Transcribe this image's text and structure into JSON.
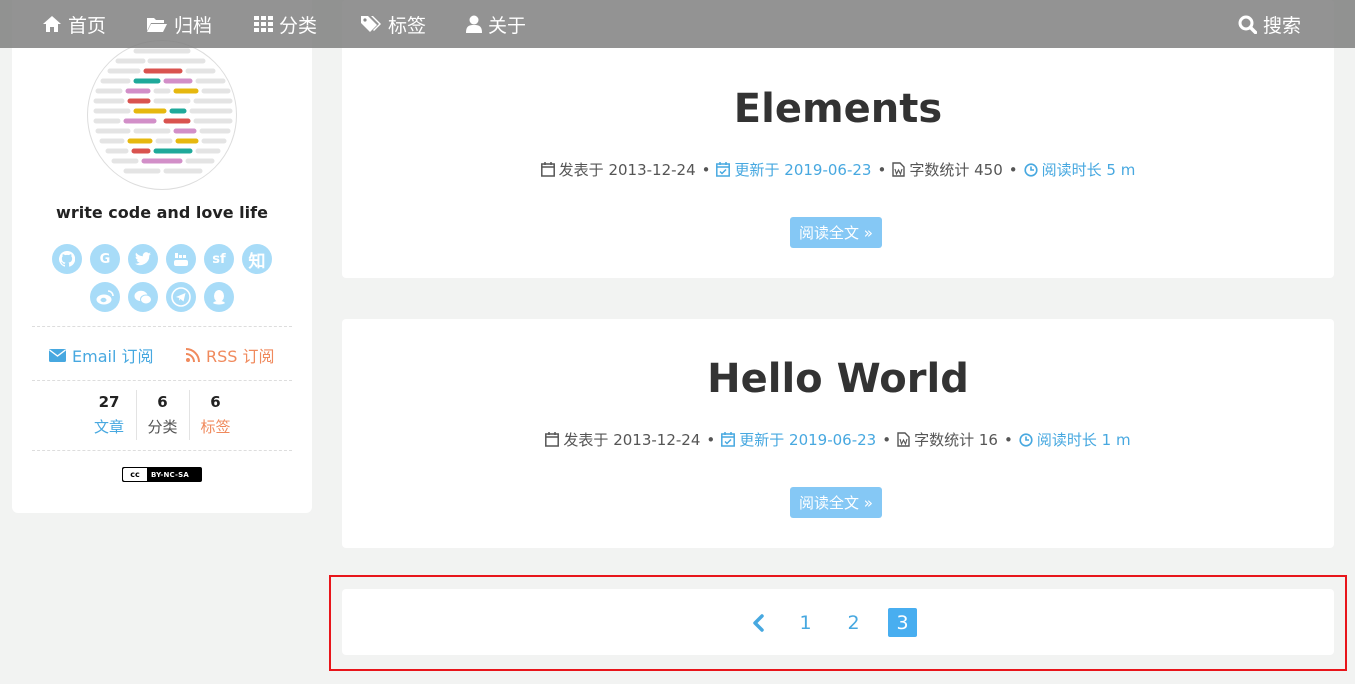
{
  "nav": {
    "home": "首页",
    "archive": "归档",
    "categories": "分类",
    "tags": "标签",
    "about": "关于",
    "search": "搜索"
  },
  "sidebar": {
    "author": "write code and love life",
    "social": [
      {
        "icon": "github-icon",
        "glyph": ""
      },
      {
        "icon": "google-icon",
        "glyph": "G"
      },
      {
        "icon": "twitter-icon",
        "glyph": ""
      },
      {
        "icon": "youtube-icon",
        "glyph": ""
      },
      {
        "icon": "segmentfault-icon",
        "glyph": "sf"
      },
      {
        "icon": "zhihu-icon",
        "glyph": "知"
      },
      {
        "icon": "weibo-icon",
        "glyph": ""
      },
      {
        "icon": "wechat-icon",
        "glyph": ""
      },
      {
        "icon": "telegram-icon",
        "glyph": ""
      },
      {
        "icon": "qq-icon",
        "glyph": ""
      }
    ],
    "email_sub": "Email 订阅",
    "rss_sub": "RSS 订阅",
    "stats": [
      {
        "num": "27",
        "label": "文章"
      },
      {
        "num": "6",
        "label": "分类"
      },
      {
        "num": "6",
        "label": "标签"
      }
    ],
    "license": "BY-NC-SA",
    "license_cc": "cc"
  },
  "posts": [
    {
      "title": "Elements",
      "posted_label": "发表于",
      "posted": "2013-12-24",
      "updated_label": "更新于",
      "updated": "2019-06-23",
      "words_label": "字数统计",
      "words": "450",
      "reading_label": "阅读时长",
      "reading": "5 m",
      "read_more": "阅读全文 »"
    },
    {
      "title": "Hello World",
      "posted_label": "发表于",
      "posted": "2013-12-24",
      "updated_label": "更新于",
      "updated": "2019-06-23",
      "words_label": "字数统计",
      "words": "16",
      "reading_label": "阅读时长",
      "reading": "1 m",
      "read_more": "阅读全文 »"
    }
  ],
  "pagination": {
    "pages": [
      "1",
      "2",
      "3"
    ],
    "current": "3"
  },
  "colors": {
    "accent": "#47a8e0",
    "rss": "#f08a5d",
    "highlight": "#e8151b"
  }
}
